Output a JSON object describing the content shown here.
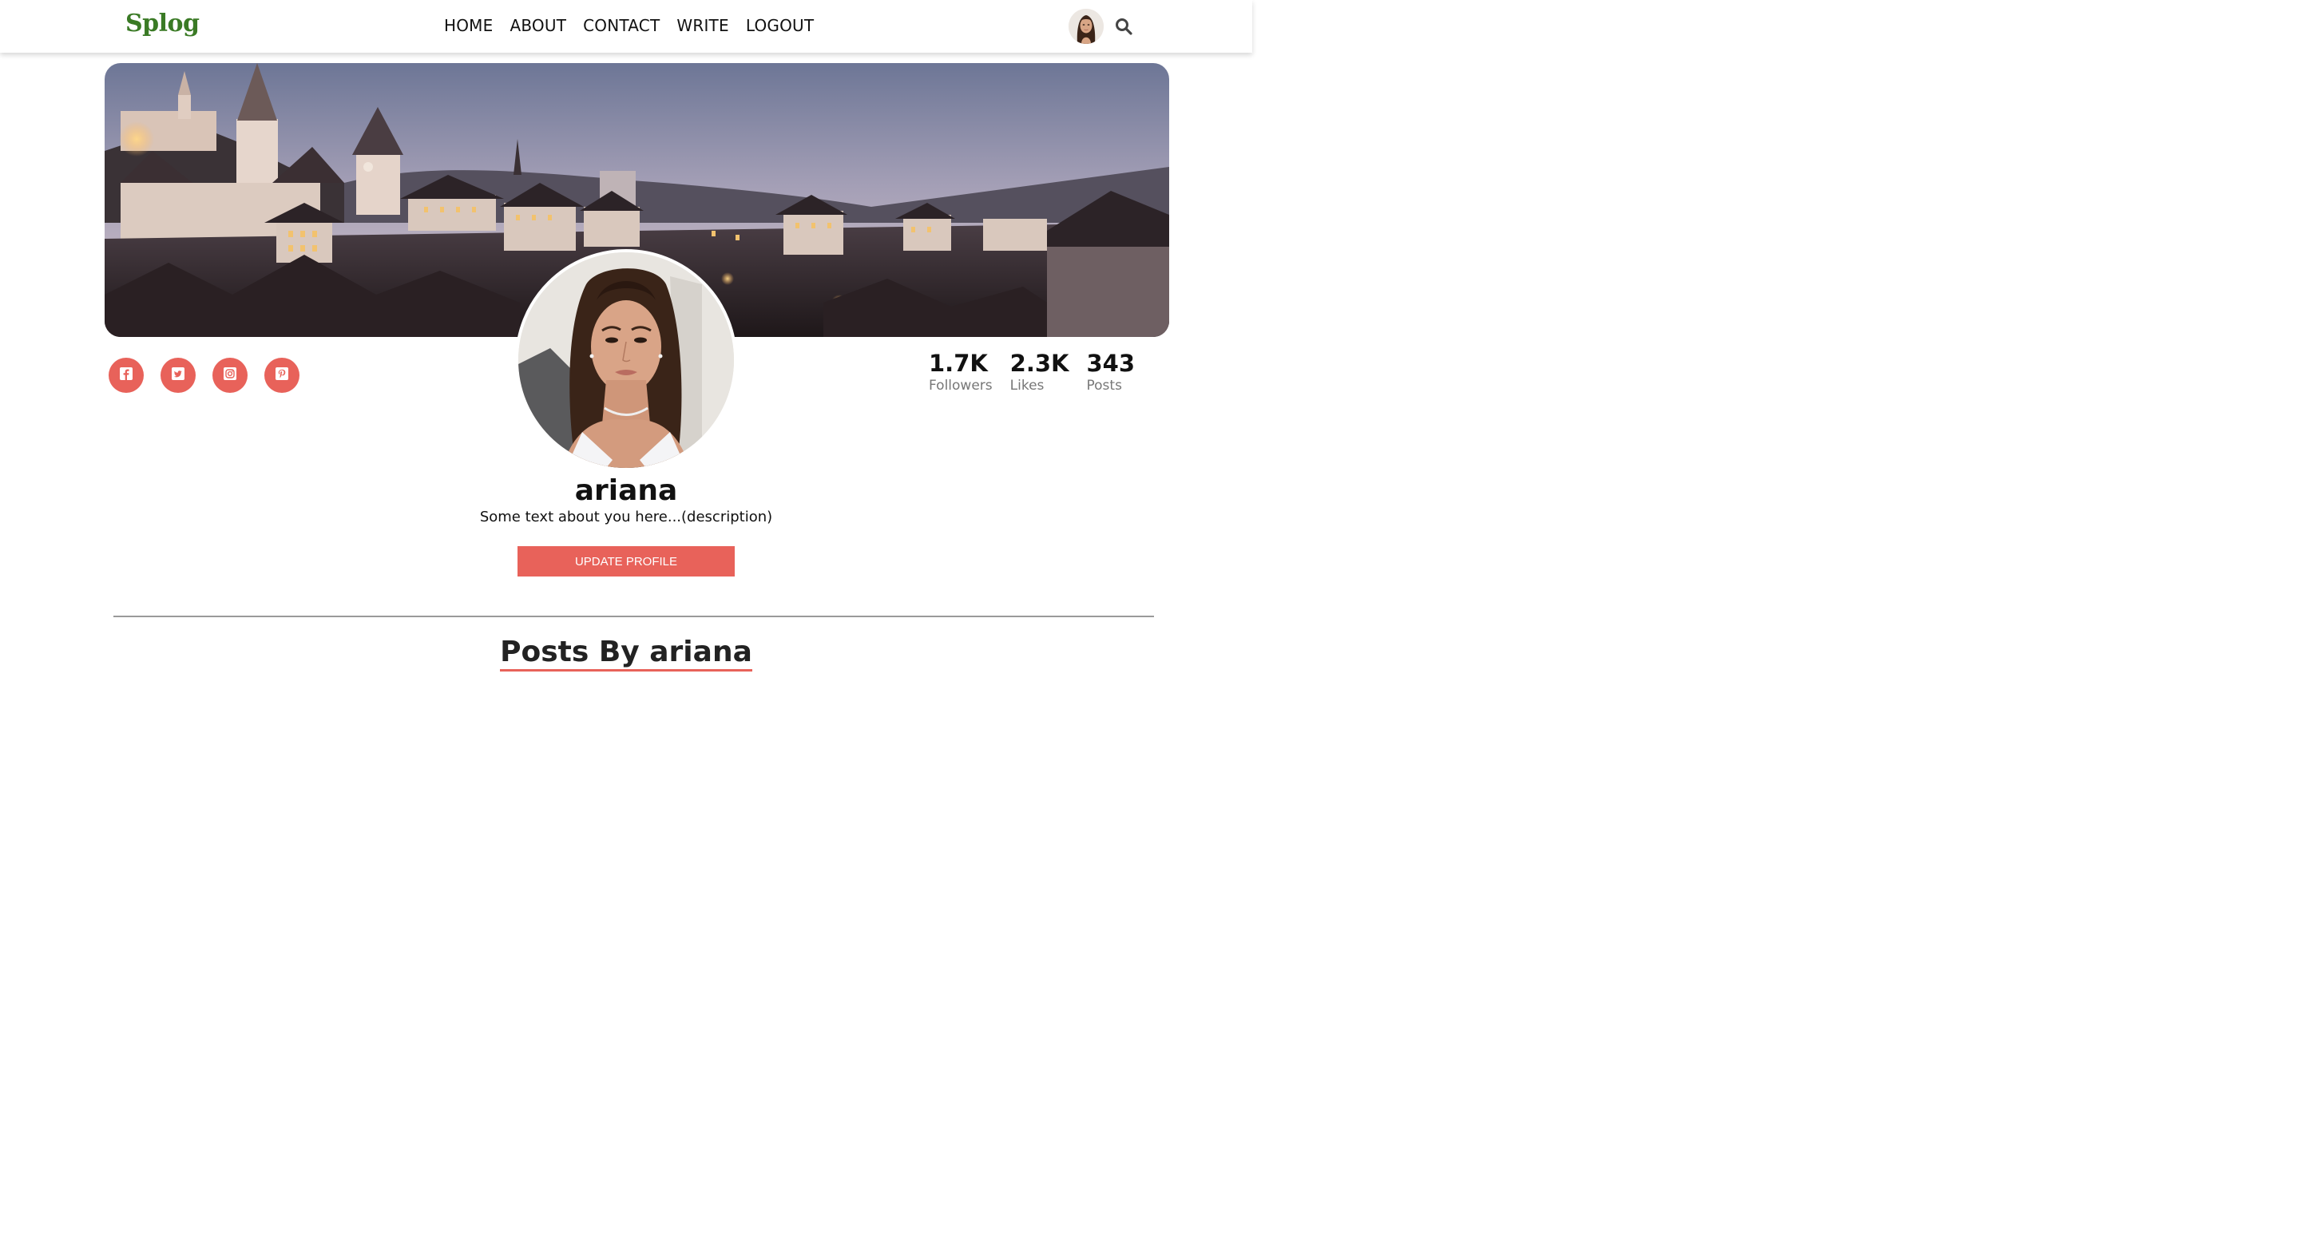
{
  "brand": {
    "logo": "Splog",
    "logo_color": "#3a7a25"
  },
  "nav": {
    "items": [
      {
        "label": "HOME"
      },
      {
        "label": "ABOUT"
      },
      {
        "label": "CONTACT"
      },
      {
        "label": "WRITE"
      },
      {
        "label": "LOGOUT"
      }
    ],
    "avatar_icon": "user-avatar",
    "search_icon": "search-icon"
  },
  "cover": {
    "image": "night-town-skyline"
  },
  "social": {
    "accent": "#e8625a",
    "links": [
      {
        "icon": "facebook-icon"
      },
      {
        "icon": "twitter-icon"
      },
      {
        "icon": "instagram-icon"
      },
      {
        "icon": "pinterest-icon"
      }
    ]
  },
  "stats": [
    {
      "value": "1.7K",
      "label": "Followers"
    },
    {
      "value": "2.3K",
      "label": "Likes"
    },
    {
      "value": "343",
      "label": "Posts"
    }
  ],
  "profile": {
    "username": "ariana",
    "description": "Some text about you here...(description)",
    "update_button": "UPDATE PROFILE"
  },
  "posts_section": {
    "title": "Posts By ariana",
    "underline_color": "#e8625a"
  }
}
